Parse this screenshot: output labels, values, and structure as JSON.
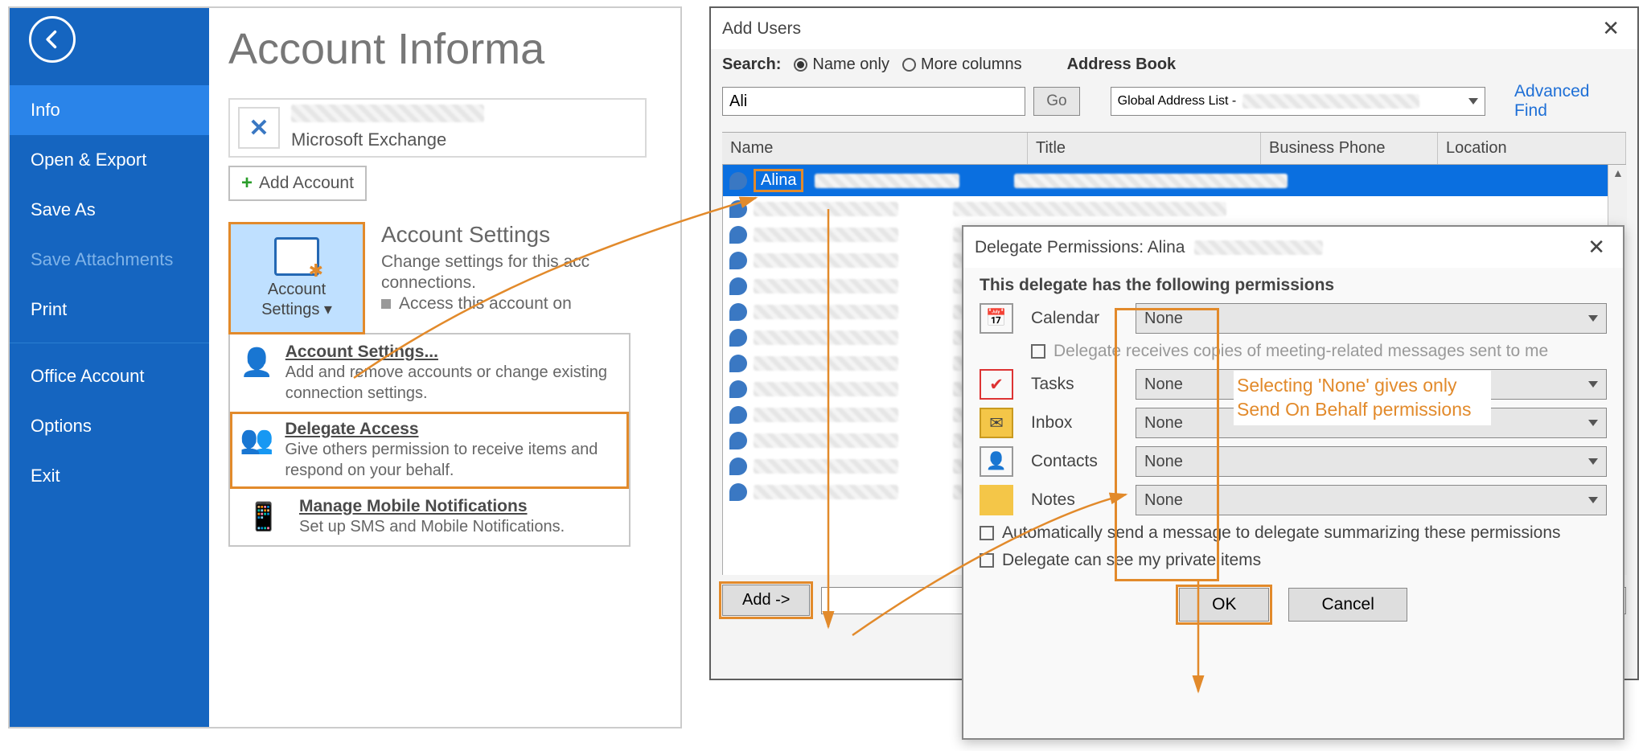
{
  "sidebar": {
    "items": [
      {
        "label": "Info",
        "active": true
      },
      {
        "label": "Open & Export"
      },
      {
        "label": "Save As"
      },
      {
        "label": "Save Attachments",
        "disabled": true
      },
      {
        "label": "Print"
      },
      {
        "label": "Office Account"
      },
      {
        "label": "Options"
      },
      {
        "label": "Exit"
      }
    ]
  },
  "page": {
    "title": "Account Informa",
    "exchange_label": "Microsoft Exchange",
    "add_account": "Add Account",
    "account_settings_btn": "Account\nSettings",
    "account_settings_caret": "▾",
    "settings_heading": "Account Settings",
    "settings_line1": "Change settings for this acc",
    "settings_line2": "connections.",
    "settings_bullet": "Access this account on"
  },
  "menu": {
    "account_settings": {
      "title": "Account Settings...",
      "desc": "Add and remove accounts or change existing connection settings."
    },
    "delegate_access": {
      "title": "Delegate Access",
      "desc": "Give others permission to receive items and respond on your behalf."
    },
    "mobile": {
      "title": "Manage Mobile Notifications",
      "desc": "Set up SMS and Mobile Notifications."
    }
  },
  "add_users": {
    "title": "Add Users",
    "search_label": "Search:",
    "radio_name": "Name only",
    "radio_more": "More columns",
    "addr_book_label": "Address Book",
    "search_value": "Ali",
    "go": "Go",
    "combo_prefix": "Global Address List -",
    "adv_find": "Advanced Find",
    "columns": [
      "Name",
      "Title",
      "Business Phone",
      "Location"
    ],
    "first_row_name": "Alina",
    "add_button": "Add ->"
  },
  "delegate": {
    "title_prefix": "Delegate Permissions: Alina",
    "heading": "This delegate has the following permissions",
    "rows": [
      {
        "label": "Calendar",
        "value": "None"
      },
      {
        "label": "Tasks",
        "value": "None"
      },
      {
        "label": "Inbox",
        "value": "None"
      },
      {
        "label": "Contacts",
        "value": "None"
      },
      {
        "label": "Notes",
        "value": "None"
      }
    ],
    "sub_cb": "Delegate receives copies of meeting-related messages sent to me",
    "cb1": "Automatically send a message to delegate summarizing these permissions",
    "cb2": "Delegate can see my private items",
    "ok": "OK",
    "cancel": "Cancel",
    "annotation": "Selecting 'None' gives only Send On Behalf permissions"
  }
}
